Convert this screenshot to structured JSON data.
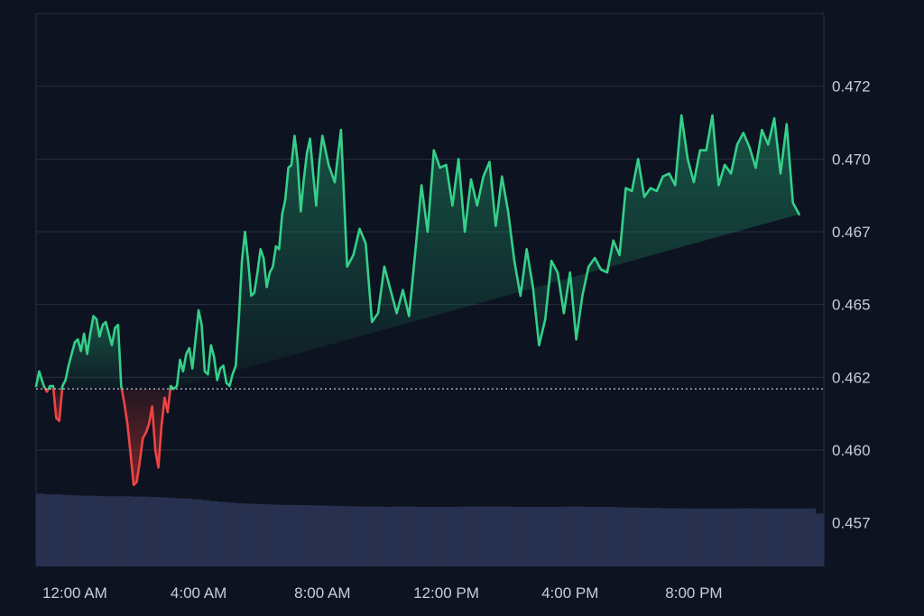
{
  "chart_data": {
    "type": "area",
    "title": "",
    "xlabel": "",
    "ylabel": "",
    "ylim": [
      0.4555,
      0.4745
    ],
    "baseline": 0.4616,
    "x_range_hours": [
      -1.25,
      24.2
    ],
    "y_ticks": [
      {
        "value": 0.457,
        "label": "0.457"
      },
      {
        "value": 0.4595,
        "label": "0.460"
      },
      {
        "value": 0.462,
        "label": "0.462"
      },
      {
        "value": 0.4645,
        "label": "0.465"
      },
      {
        "value": 0.467,
        "label": "0.467"
      },
      {
        "value": 0.4695,
        "label": "0.470"
      },
      {
        "value": 0.472,
        "label": "0.472"
      }
    ],
    "x_ticks": [
      {
        "value": 0,
        "label": "12:00 AM"
      },
      {
        "value": 4,
        "label": "4:00 AM"
      },
      {
        "value": 8,
        "label": "8:00 AM"
      },
      {
        "value": 12,
        "label": "12:00 PM"
      },
      {
        "value": 16,
        "label": "4:00 PM"
      },
      {
        "value": 20,
        "label": "8:00 PM"
      }
    ],
    "x_hours": [
      -1.25,
      -1.15,
      -1.0,
      -0.9,
      -0.8,
      -0.7,
      -0.6,
      -0.5,
      -0.4,
      -0.3,
      -0.2,
      -0.1,
      0.0,
      0.1,
      0.2,
      0.3,
      0.4,
      0.5,
      0.6,
      0.7,
      0.8,
      0.9,
      1.0,
      1.1,
      1.2,
      1.3,
      1.4,
      1.5,
      1.6,
      1.7,
      1.8,
      1.9,
      2.0,
      2.1,
      2.2,
      2.3,
      2.4,
      2.5,
      2.6,
      2.7,
      2.8,
      2.9,
      3.0,
      3.1,
      3.2,
      3.3,
      3.4,
      3.5,
      3.6,
      3.7,
      3.8,
      3.9,
      4.0,
      4.1,
      4.2,
      4.3,
      4.4,
      4.5,
      4.6,
      4.7,
      4.8,
      4.9,
      5.0,
      5.1,
      5.2,
      5.3,
      5.4,
      5.5,
      5.6,
      5.7,
      5.8,
      5.9,
      6.0,
      6.1,
      6.2,
      6.3,
      6.4,
      6.5,
      6.6,
      6.7,
      6.8,
      6.9,
      7.0,
      7.1,
      7.2,
      7.3,
      7.4,
      7.5,
      7.6,
      7.7,
      7.8,
      7.9,
      8.0,
      8.2,
      8.4,
      8.6,
      8.8,
      9.0,
      9.2,
      9.4,
      9.6,
      9.8,
      10.0,
      10.2,
      10.4,
      10.6,
      10.8,
      11.0,
      11.2,
      11.4,
      11.6,
      11.8,
      12.0,
      12.2,
      12.4,
      12.6,
      12.8,
      13.0,
      13.2,
      13.4,
      13.6,
      13.8,
      14.0,
      14.2,
      14.4,
      14.6,
      14.8,
      15.0,
      15.2,
      15.4,
      15.6,
      15.8,
      16.0,
      16.2,
      16.4,
      16.6,
      16.8,
      17.0,
      17.2,
      17.4,
      17.6,
      17.8,
      18.0,
      18.2,
      18.4,
      18.6,
      18.8,
      19.0,
      19.2,
      19.4,
      19.6,
      19.8,
      20.0,
      20.2,
      20.4,
      20.6,
      20.8,
      21.0,
      21.2,
      21.4,
      21.6,
      21.8,
      22.0,
      22.2,
      22.4,
      22.6,
      22.8,
      23.0,
      23.2,
      23.4,
      23.6,
      23.8,
      24.0,
      24.2
    ],
    "series": [
      {
        "values": [
          0.4617,
          0.4622,
          0.4617,
          0.4615,
          0.4617,
          0.4617,
          0.4606,
          0.4605,
          0.4617,
          0.4619,
          0.4624,
          0.4628,
          0.4632,
          0.4633,
          0.4629,
          0.4635,
          0.4628,
          0.4635,
          0.4641,
          0.464,
          0.4634,
          0.4638,
          0.4639,
          0.4635,
          0.4631,
          0.4637,
          0.4638,
          0.4617,
          0.4611,
          0.4604,
          0.4594,
          0.4583,
          0.4584,
          0.4591,
          0.4599,
          0.4601,
          0.4604,
          0.461,
          0.4595,
          0.4589,
          0.4603,
          0.4613,
          0.4608,
          0.4617,
          0.4616,
          0.4617,
          0.4626,
          0.4622,
          0.4628,
          0.463,
          0.4623,
          0.4633,
          0.4643,
          0.4638,
          0.4622,
          0.4621,
          0.4631,
          0.4627,
          0.4619,
          0.4623,
          0.4624,
          0.4618,
          0.4617,
          0.4621,
          0.4624,
          0.464,
          0.466,
          0.467,
          0.466,
          0.4648,
          0.4649,
          0.4656,
          0.4664,
          0.4661,
          0.4651,
          0.4656,
          0.4658,
          0.4665,
          0.4664,
          0.4676,
          0.4681,
          0.4692,
          0.4693,
          0.4703,
          0.4694,
          0.4677,
          0.4688,
          0.4697,
          0.4702,
          0.469,
          0.4679,
          0.4694,
          0.4703,
          0.4693,
          0.4687,
          0.4705,
          0.4658,
          0.4662,
          0.4671,
          0.4666,
          0.4639,
          0.4642,
          0.4658,
          0.465,
          0.4642,
          0.465,
          0.4641,
          0.4663,
          0.4686,
          0.467,
          0.4698,
          0.4692,
          0.4693,
          0.4679,
          0.4695,
          0.467,
          0.4688,
          0.4679,
          0.4689,
          0.4694,
          0.4672,
          0.4689,
          0.4677,
          0.466,
          0.4648,
          0.4664,
          0.4651,
          0.4631,
          0.464,
          0.466,
          0.4656,
          0.4642,
          0.4656,
          0.4633,
          0.4648,
          0.4658,
          0.4661,
          0.4657,
          0.4656,
          0.4667,
          0.4662,
          0.4685,
          0.4684,
          0.4695,
          0.4682,
          0.4685,
          0.4684,
          0.4689,
          0.469,
          0.4686,
          0.471,
          0.4695,
          0.4687,
          0.4698,
          0.4698,
          0.471,
          0.4686,
          0.4693,
          0.469,
          0.47,
          0.4704,
          0.4699,
          0.4692,
          0.4705,
          0.47,
          0.4709,
          0.469,
          0.4707,
          0.468,
          0.4676
        ]
      }
    ],
    "volume": [
      0.22,
      0.218,
      0.218,
      0.216,
      0.215,
      0.214,
      0.214,
      0.213,
      0.212,
      0.212,
      0.212,
      0.211,
      0.211,
      0.21,
      0.209,
      0.208,
      0.206,
      0.205,
      0.203,
      0.2,
      0.197,
      0.195,
      0.193,
      0.191,
      0.19,
      0.189,
      0.188,
      0.187,
      0.186,
      0.186,
      0.185,
      0.185,
      0.184,
      0.184,
      0.183,
      0.182,
      0.182,
      0.181,
      0.181,
      0.181,
      0.18,
      0.181,
      0.181,
      0.181,
      0.18,
      0.18,
      0.18,
      0.18,
      0.18,
      0.181,
      0.181,
      0.181,
      0.181,
      0.181,
      0.181,
      0.18,
      0.18,
      0.18,
      0.18,
      0.18,
      0.18,
      0.181,
      0.181,
      0.18,
      0.18,
      0.18,
      0.18,
      0.179,
      0.178,
      0.178,
      0.177,
      0.177,
      0.176,
      0.176,
      0.176,
      0.175,
      0.175,
      0.175,
      0.175,
      0.175,
      0.175,
      0.176,
      0.176,
      0.175,
      0.175,
      0.175,
      0.175,
      0.175,
      0.175,
      0.176,
      0.16
    ],
    "colors": {
      "background": "#0d1320",
      "grid": "#283040",
      "up_line": "#34d08a",
      "down_line": "#ef4444",
      "up_fill": "#1f8a63",
      "down_fill": "#9b2c2c",
      "baseline": "#c9ced8",
      "volume": "#28304f",
      "tick_text": "#c9ced8"
    },
    "grid": true,
    "legend": "none"
  }
}
